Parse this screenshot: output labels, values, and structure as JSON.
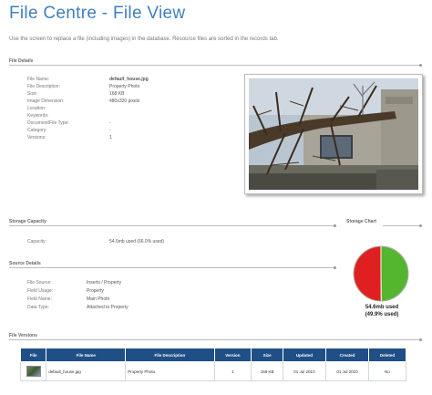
{
  "page": {
    "title": "File Centre - File View",
    "intro": "Use the screen to replace a file (including images) in the database. Resource files are sorted in the records tab."
  },
  "sections": {
    "file_details": "File Details",
    "storage_capacity": "Storage Capacity",
    "storage_chart": "Storage Chart",
    "source_details": "Source Details",
    "file_versions": "File Versions"
  },
  "file_details": [
    {
      "label": "File Name:",
      "value": "default_house.jpg"
    },
    {
      "label": "File Description:",
      "value": "Property Photo"
    },
    {
      "label": "Size:",
      "value": "168 KB"
    },
    {
      "label": "Image Dimension:",
      "value": "480x320 pixels"
    },
    {
      "label": "Location:",
      "value": ""
    },
    {
      "label": "Keywords:",
      "value": ""
    },
    {
      "label": "Document/File Type:",
      "value": "-"
    },
    {
      "label": "Category:",
      "value": "-"
    },
    {
      "label": "Versions:",
      "value": "1"
    }
  ],
  "storage": {
    "label": "Capacity:",
    "value": "54.6mb used (66.0% used)"
  },
  "source_details": [
    {
      "label": "File Source:",
      "value": "Inserts / Property"
    },
    {
      "label": "Field Usage:",
      "value": "Property"
    },
    {
      "label": "Field Name:",
      "value": "Main Photo"
    },
    {
      "label": "Data Type:",
      "value": "Attached to Property"
    }
  ],
  "chart_data": {
    "type": "pie",
    "slices": [
      {
        "name": "used",
        "percent": 49.9,
        "color": "#54b52f"
      },
      {
        "name": "free",
        "percent": 50.1,
        "color": "#e02020"
      }
    ],
    "label_line1": "54.6mb used",
    "label_line2": "(49.9% used)"
  },
  "versions_table": {
    "headers": [
      "File",
      "File Name",
      "File Description",
      "Version",
      "Size",
      "Updated",
      "Created",
      "Deleted"
    ],
    "rows": [
      [
        "",
        "default_house.jpg",
        "Property Photo",
        "1",
        "168 KB",
        "01 Jul 2010",
        "01 Jul 2010",
        "No"
      ]
    ]
  }
}
